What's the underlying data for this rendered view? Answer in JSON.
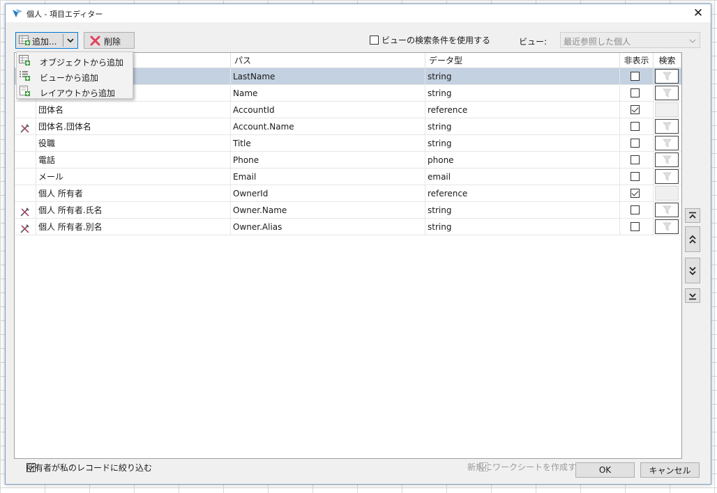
{
  "window": {
    "title": "個人 - 項目エディター"
  },
  "toolbar": {
    "add_label": "追加...",
    "delete_label": "削除"
  },
  "view_filter": {
    "use_view_search_label": "ビューの検索条件を使用する",
    "view_label": "ビュー:",
    "view_value": "最近参照した個人"
  },
  "add_menu": {
    "items": [
      {
        "label": "オブジェクトから追加"
      },
      {
        "label": "ビューから追加"
      },
      {
        "label": "レイアウトから追加"
      }
    ]
  },
  "grid": {
    "columns": {
      "path": "パス",
      "data_type": "データ型",
      "hidden": "非表示",
      "search": "検索"
    },
    "rows": [
      {
        "name": "",
        "path": "LastName",
        "type": "string",
        "hidden": false,
        "searchable": true,
        "formula_icon": false,
        "selected": true
      },
      {
        "name": "",
        "path": "Name",
        "type": "string",
        "hidden": false,
        "searchable": true,
        "formula_icon": false,
        "selected": false
      },
      {
        "name": "団体名",
        "path": "AccountId",
        "type": "reference",
        "hidden": true,
        "searchable": false,
        "formula_icon": false,
        "selected": false
      },
      {
        "name": "団体名.団体名",
        "path": "Account.Name",
        "type": "string",
        "hidden": false,
        "searchable": true,
        "formula_icon": true,
        "selected": false
      },
      {
        "name": "役職",
        "path": "Title",
        "type": "string",
        "hidden": false,
        "searchable": true,
        "formula_icon": false,
        "selected": false
      },
      {
        "name": "電話",
        "path": "Phone",
        "type": "phone",
        "hidden": false,
        "searchable": true,
        "formula_icon": false,
        "selected": false
      },
      {
        "name": "メール",
        "path": "Email",
        "type": "email",
        "hidden": false,
        "searchable": true,
        "formula_icon": false,
        "selected": false
      },
      {
        "name": "個人 所有者",
        "path": "OwnerId",
        "type": "reference",
        "hidden": true,
        "searchable": false,
        "formula_icon": false,
        "selected": false
      },
      {
        "name": "個人 所有者.氏名",
        "path": "Owner.Name",
        "type": "string",
        "hidden": false,
        "searchable": true,
        "formula_icon": true,
        "selected": false
      },
      {
        "name": "個人 所有者.別名",
        "path": "Owner.Alias",
        "type": "string",
        "hidden": false,
        "searchable": true,
        "formula_icon": true,
        "selected": false
      }
    ]
  },
  "footer": {
    "my_records_label": "所有者が私のレコードに絞り込む",
    "new_worksheet_label": "新規にワークシートを作成する",
    "ok_label": "OK",
    "cancel_label": "キャンセル"
  },
  "colors": {
    "selected_row": "#c3d1e1",
    "focus_border": "#0078d7",
    "delete_icon": "#e0405a",
    "formula_icon_accent": "#b04070"
  }
}
